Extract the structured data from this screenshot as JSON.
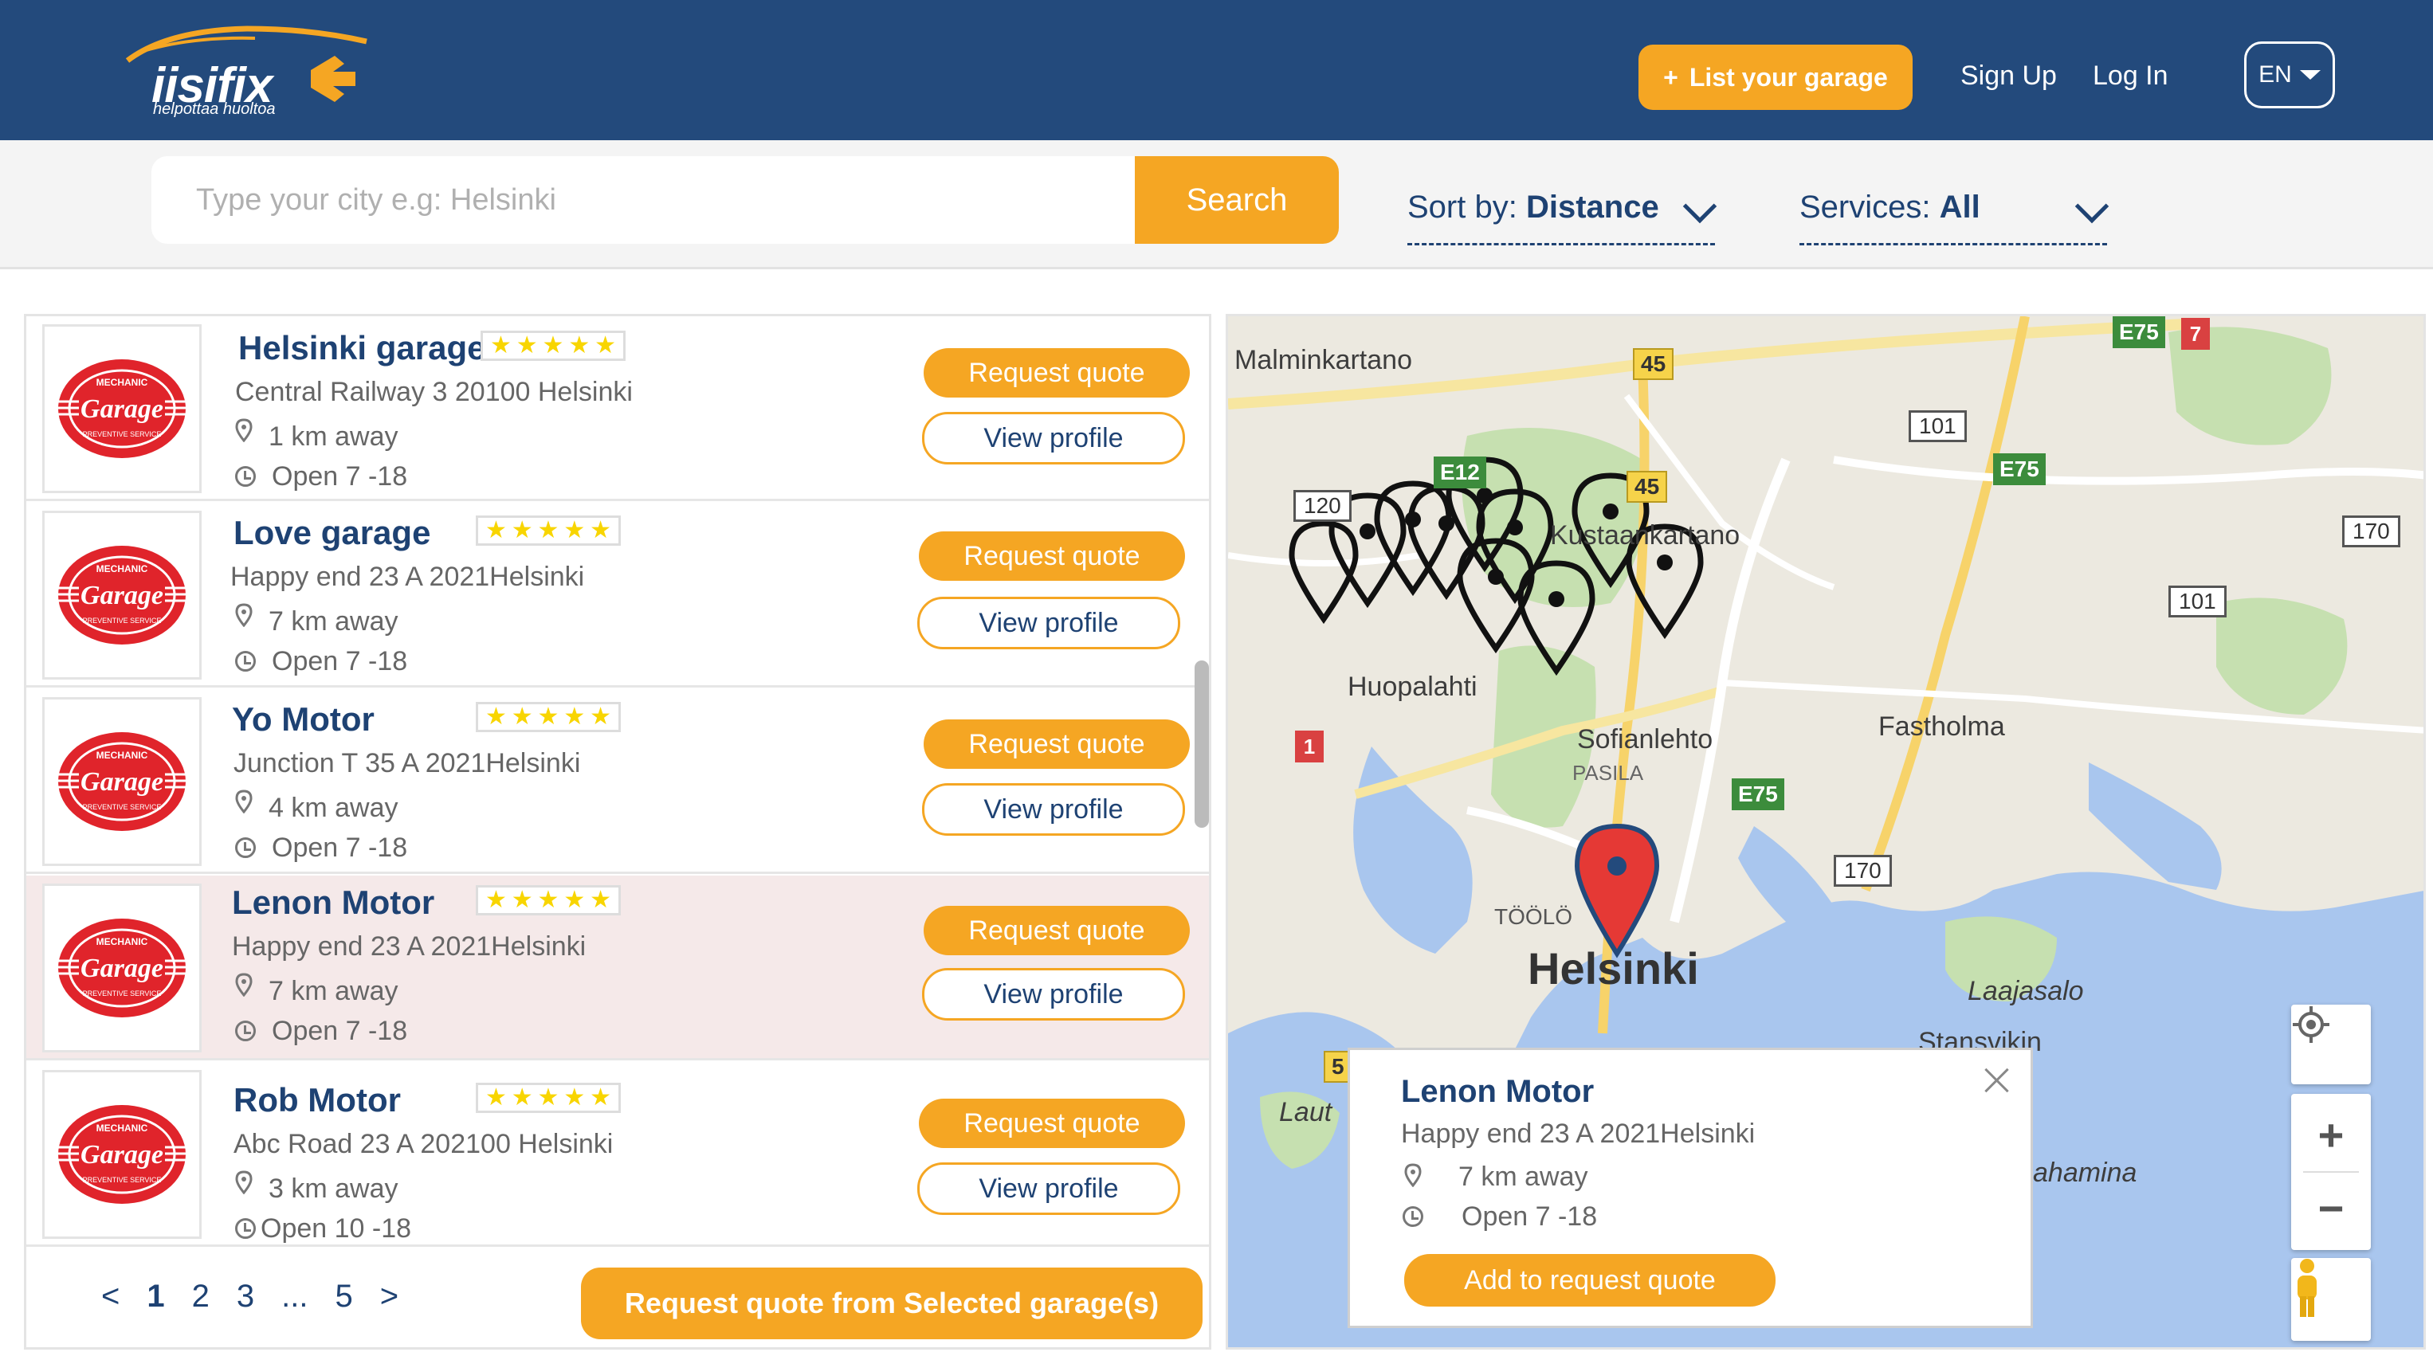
{
  "header": {
    "logo_word": "iisifix",
    "logo_tagline": "helpottaa huoltoa",
    "list_garage_label": "List your garage",
    "sign_up_label": "Sign Up",
    "log_in_label": "Log  In",
    "language": "EN"
  },
  "search": {
    "placeholder": "Type your city e.g: Helsinki",
    "value": "",
    "button_label": "Search"
  },
  "filters": {
    "sort_label": "Sort by:",
    "sort_value": "Distance",
    "services_label": "Services:",
    "services_value": "All"
  },
  "garages": [
    {
      "name": "Helsinki garage",
      "address": "Central Railway 3 20100 Helsinki",
      "distance": "1 km away",
      "hours": "Open 7 -18",
      "rating": 5
    },
    {
      "name": "Love garage",
      "address": "Happy end 23 A 2021Helsinki",
      "distance": "7 km away",
      "hours": "Open 7 -18",
      "rating": 5
    },
    {
      "name": "Yo Motor",
      "address": "Junction T 35 A 2021Helsinki",
      "distance": "4 km away",
      "hours": "Open 7 -18",
      "rating": 5
    },
    {
      "name": "Lenon Motor",
      "address": "Happy end 23 A 2021Helsinki",
      "distance": "7 km away",
      "hours": "Open 7 -18",
      "rating": 5
    },
    {
      "name": "Rob Motor",
      "address": "Abc Road 23 A 202100 Helsinki",
      "distance": "3 km away",
      "hours": "Open 10 -18",
      "rating": 5
    }
  ],
  "row_buttons": {
    "request_quote": "Request quote",
    "view_profile": "View profile"
  },
  "thumbnail": {
    "top": "MECHANIC",
    "main": "Garage",
    "bottom": "PREVENTIVE SERVICE",
    "color": "#e0242b"
  },
  "pagination": {
    "prev": "<",
    "pages": [
      "1",
      "2",
      "3",
      "...",
      "5"
    ],
    "next": ">",
    "current": "1"
  },
  "request_selected_label": "Request quote from Selected garage(s)",
  "map": {
    "places": {
      "malminkartano": "Malminkartano",
      "kustaankartano": "Kustaankartano",
      "huopalahti": "Huopalahti",
      "sofianlehto": "Sofianlehto",
      "pasila": "PASILA",
      "fastholma": "Fastholma",
      "toolo": "TÖÖLÖ",
      "helsinki": "Helsinki",
      "laajasalo": "Laajasalo",
      "stansvik": "Stansvikin",
      "lauttasaari": "Laut",
      "vuosaari_hamina": "ahamina"
    },
    "roads": {
      "e75_top": "E75",
      "r7": "7",
      "y45_a": "45",
      "y45_b": "45",
      "r101_a": "101",
      "e12": "E12",
      "e75_mid": "E75",
      "r120": "120",
      "r170_right": "170",
      "r101_b": "101",
      "r1": "1",
      "e75_low": "E75",
      "r170_low": "170",
      "y5": "5"
    },
    "popup": {
      "name": "Lenon Motor",
      "address": "Happy end 23 A 2021Helsinki",
      "distance": "7 km away",
      "hours": "Open 7 -18",
      "button_label": "Add to request quote"
    },
    "controls": {
      "zoom_in": "+",
      "zoom_out": "−"
    }
  },
  "colors": {
    "header_bg": "#234a7c",
    "accent": "#f5a623",
    "text_primary": "#1e4273",
    "highlight_row": "#f5e9e9",
    "marker_red": "#e53935"
  }
}
